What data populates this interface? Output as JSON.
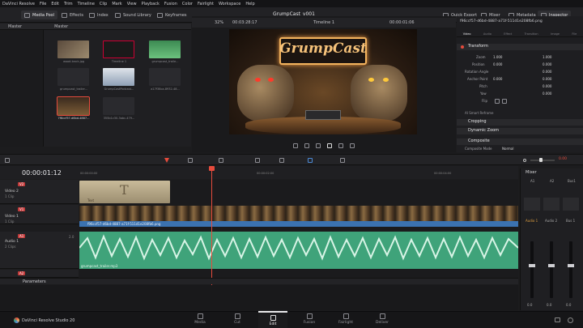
{
  "menu": [
    "DaVinci Resolve",
    "File",
    "Edit",
    "Trim",
    "Timeline",
    "Clip",
    "Mark",
    "View",
    "Playback",
    "Fusion",
    "Color",
    "Fairlight",
    "Workspace",
    "Help"
  ],
  "toolbar": {
    "media_pool": "Media Pool",
    "effects": "Effects",
    "index": "Index",
    "sound_library": "Sound Library",
    "keyframes": "Keyframes",
    "project_title": "GrumpCast_v001",
    "quick_export": "Quick Export",
    "mixer": "Mixer",
    "metadata": "Metadata",
    "inspector": "Inspector"
  },
  "media_pool": {
    "tabs": [
      "Master",
      "Master"
    ],
    "clips": [
      {
        "name": "wood-track.jpg"
      },
      {
        "name": "Timeline 1"
      },
      {
        "name": "grumpcast_traile..."
      },
      {
        "name": "grumpcast_trailer..."
      },
      {
        "name": "GrumpCastPodcast..."
      },
      {
        "name": "a17f38ca-8932-48..."
      },
      {
        "name": "7f6ccf57-d6bd-4887..."
      },
      {
        "name": "355b1c30-3abc-479..."
      }
    ]
  },
  "viewer": {
    "zoom": "32%",
    "timecode_left": "00:03:28:17",
    "timeline_name": "Timeline 1",
    "timecode_right": "00:00:01:06",
    "logo_text": "GrumpCast"
  },
  "inspector": {
    "clip_title": "f96ccf57-d6bd-4887-a71f-511d1e208fb6.png",
    "tabs": [
      "Video",
      "Audio",
      "Effect",
      "Transition",
      "Image",
      "File"
    ],
    "transform": "Transform",
    "zoom_label": "Zoom",
    "zoom_x": "1.000",
    "zoom_y": "1.000",
    "position_label": "Position",
    "pos_x": "0.000",
    "pos_y": "0.000",
    "rotation_label": "Rotation Angle",
    "rotation": "0.000",
    "anchor_label": "Anchor Point",
    "anchor_x": "0.000",
    "anchor_y": "0.000",
    "pitch_label": "Pitch",
    "pitch": "0.000",
    "yaw_label": "Yaw",
    "yaw": "0.000",
    "flip_label": "Flip",
    "smart_reframe": "AI Smart Reframe",
    "cropping": "Cropping",
    "dynamic_zoom": "Dynamic Zoom",
    "composite": "Composite",
    "composite_mode_label": "Composite Mode",
    "composite_mode": "Normal",
    "volume": "0.00"
  },
  "timeline": {
    "timecode": "00:00:01:12",
    "ruler": [
      "00:00:00:00",
      "00:00:02:00",
      "00:00:04:00"
    ],
    "tracks": [
      {
        "id": "V2",
        "name": "Video 2",
        "clips": "1 Clip"
      },
      {
        "id": "V1",
        "name": "Video 1",
        "clips": "1 Clip"
      },
      {
        "id": "A1",
        "name": "Audio 1",
        "clips": "2 Clips",
        "level": "2.0"
      }
    ],
    "title_clip": "Text",
    "title_glyph": "T",
    "video_clip": "f96ccf57-d6bd-4887-a71f-511d1e208fb6.png",
    "audio_clip": "grumpcast_trailer.mp3",
    "a2": "A2",
    "parameters": "Parameters"
  },
  "mixer": {
    "title": "Mixer",
    "channels": [
      "A1",
      "A2",
      "Bus1"
    ],
    "labels": [
      "Audio 1",
      "Audio 2",
      "Bus 1"
    ],
    "levels": [
      "0.0",
      "0.0",
      "0.0"
    ]
  },
  "pages": [
    "Media",
    "Cut",
    "Edit",
    "Fusion",
    "Fairlight",
    "Deliver"
  ],
  "footer": {
    "app": "DaVinci Resolve Studio 20"
  },
  "colors": {
    "accent": "#e64b3c",
    "video_track": "#3b72b0",
    "audio_track": "#3fa37a",
    "title_clip": "#b6a98a"
  }
}
